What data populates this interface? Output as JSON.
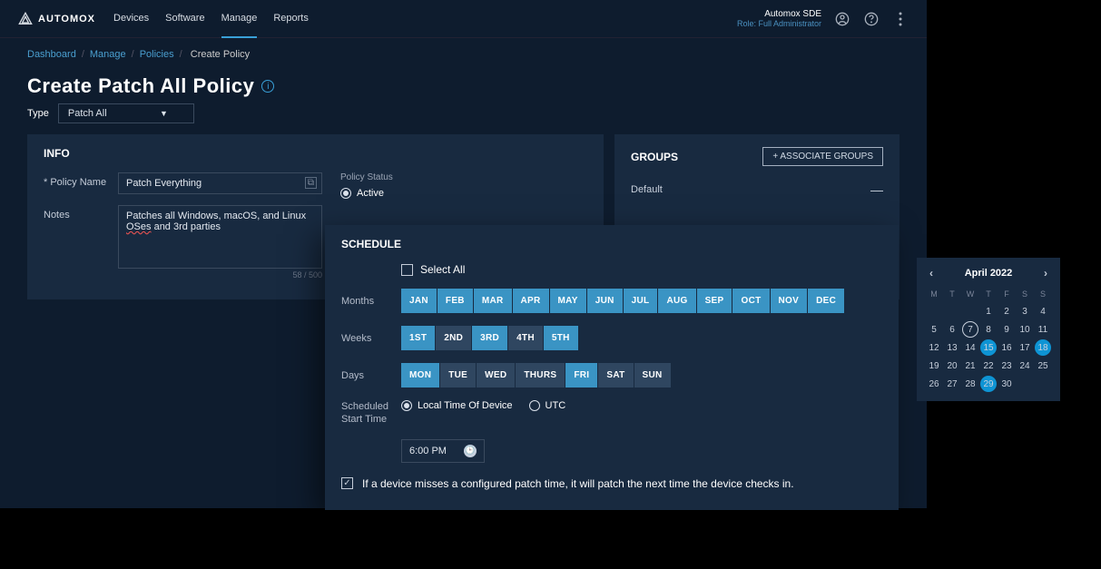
{
  "brand": "AUTOMOX",
  "nav": {
    "tabs": [
      "Devices",
      "Software",
      "Manage",
      "Reports"
    ],
    "active_index": 2
  },
  "account": {
    "org": "Automox SDE",
    "role": "Role: Full Administrator"
  },
  "crumbs": {
    "links": [
      "Dashboard",
      "Manage",
      "Policies"
    ],
    "current": "Create Policy"
  },
  "page_title": "Create Patch All Policy",
  "type": {
    "label": "Type",
    "value": "Patch All"
  },
  "info": {
    "heading": "INFO",
    "name_label": "* Policy Name",
    "name_value": "Patch Everything",
    "notes_label": "Notes",
    "notes_pre": "Patches all Windows, macOS, and Linux ",
    "notes_mis": "OSes",
    "notes_post": " and 3rd parties",
    "charcount": "58 / 500",
    "status_label": "Policy Status",
    "status_options": [
      "Active"
    ]
  },
  "groups": {
    "heading": "GROUPS",
    "assoc_btn": "+  ASSOCIATE GROUPS",
    "items": [
      "Default"
    ]
  },
  "schedule": {
    "heading": "SCHEDULE",
    "select_all": "Select All",
    "months_label": "Months",
    "months": [
      "JAN",
      "FEB",
      "MAR",
      "APR",
      "MAY",
      "JUN",
      "JUL",
      "AUG",
      "SEP",
      "OCT",
      "NOV",
      "DEC"
    ],
    "months_sel": [
      0,
      1,
      2,
      3,
      4,
      5,
      6,
      7,
      8,
      9,
      10,
      11
    ],
    "weeks_label": "Weeks",
    "weeks": [
      "1ST",
      "2ND",
      "3RD",
      "4TH",
      "5TH"
    ],
    "weeks_sel": [
      0,
      2,
      4
    ],
    "days_label": "Days",
    "days": [
      "MON",
      "TUE",
      "WED",
      "THURS",
      "FRI",
      "SAT",
      "SUN"
    ],
    "days_sel": [
      0,
      4
    ],
    "start_label": "Scheduled Start Time",
    "tz_local": "Local Time Of Device",
    "tz_utc": "UTC",
    "time_value": "6:00 PM",
    "miss_text": "If a device misses a configured patch time, it will patch the next time the device checks in."
  },
  "calendar": {
    "title": "April 2022",
    "dow": [
      "M",
      "T",
      "W",
      "T",
      "F",
      "S",
      "S"
    ],
    "leading_blanks": 3,
    "days": 30,
    "today": 7,
    "selected": [
      15,
      18,
      29
    ]
  }
}
